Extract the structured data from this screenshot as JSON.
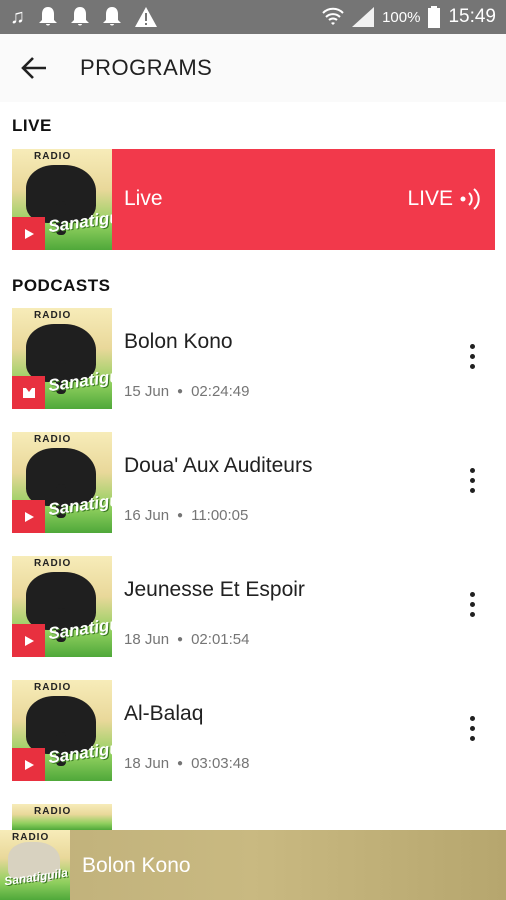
{
  "status_bar": {
    "battery": "100%",
    "time": "15:49"
  },
  "app_bar": {
    "title": "PROGRAMS"
  },
  "sections": {
    "live_label": "LIVE",
    "podcasts_label": "PODCASTS"
  },
  "live": {
    "title": "Live",
    "badge": "LIVE",
    "color": "#f2394b"
  },
  "thumb_text": {
    "top": "RADIO",
    "name": "Sanatiguila"
  },
  "podcasts": [
    {
      "title": "Bolon Kono",
      "date": "15 Jun",
      "duration": "02:24:49"
    },
    {
      "title": "Doua' Aux Auditeurs",
      "date": "16 Jun",
      "duration": "11:00:05"
    },
    {
      "title": "Jeunesse Et Espoir",
      "date": "18 Jun",
      "duration": "02:01:54"
    },
    {
      "title": "Al-Balaq",
      "date": "18 Jun",
      "duration": "03:03:48"
    }
  ],
  "mini_player": {
    "title": "Bolon Kono"
  },
  "icons": {
    "back": "arrow-left-icon",
    "more": "more-vert-icon",
    "play": "play-icon",
    "pause": "pause-icon",
    "live": "live-broadcast-icon"
  }
}
